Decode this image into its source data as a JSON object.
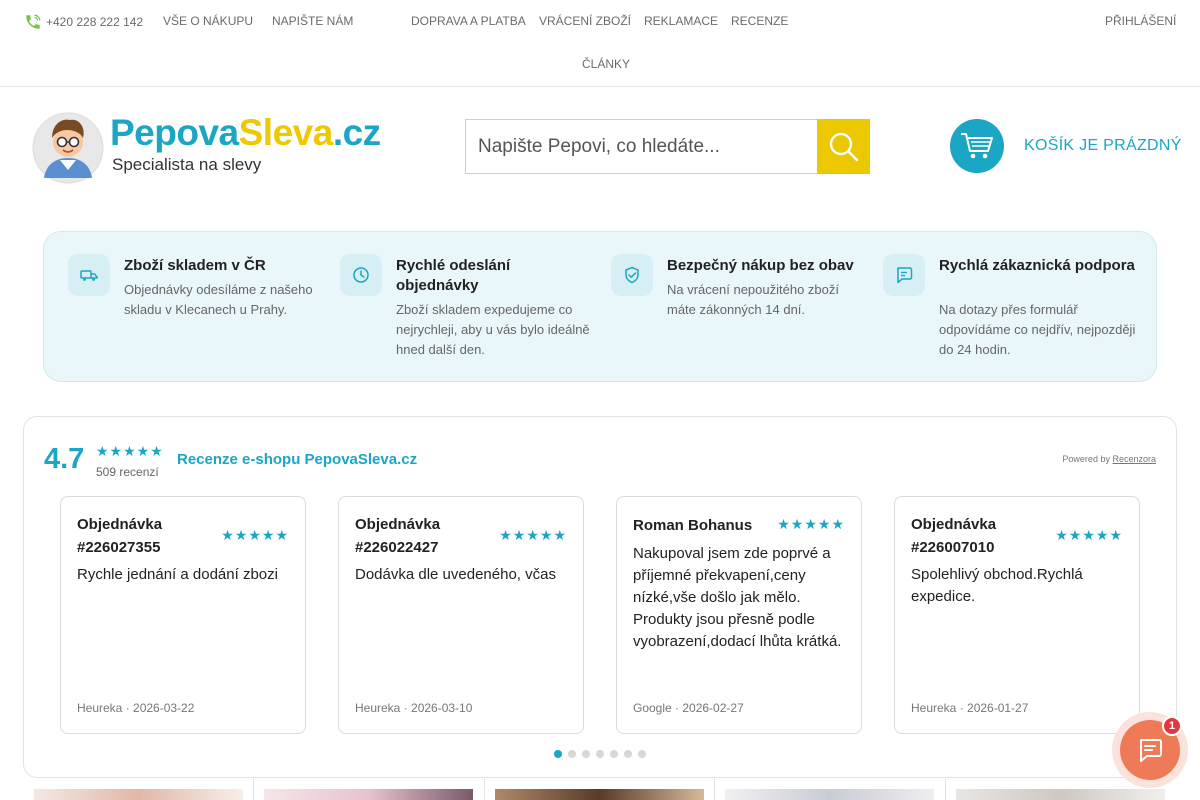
{
  "topbar": {
    "phone": "+420 228 222 142",
    "links": [
      "VŠE O NÁKUPU",
      "NAPIŠTE NÁM",
      "DOPRAVA A PLATBA",
      "VRÁCENÍ ZBOŽÍ",
      "REKLAMACE",
      "RECENZE",
      "ČLÁNKY"
    ],
    "login": "PŘIHLÁŠENÍ"
  },
  "header": {
    "brand_part1": "Pepova",
    "brand_part2": "Sleva",
    "brand_part3": ".cz",
    "tagline": "Specialista na slevy",
    "search_placeholder": "Napište Pepovi, co hledáte...",
    "cart_label": "KOŠÍK JE PRÁZDNÝ"
  },
  "benefits": [
    {
      "icon": "truck-icon",
      "title": "Zboží skladem v ČR",
      "desc": "Objednávky odesíláme z našeho skladu v Klecanech u Prahy."
    },
    {
      "icon": "clock-icon",
      "title": "Rychlé odeslání objednávky",
      "desc": "Zboží skladem expedujeme co nejrychleji, aby u vás bylo ideálně hned další den."
    },
    {
      "icon": "shield-check-icon",
      "title": "Bezpečný nákup bez obav",
      "desc": "Na vrácení nepoužitého zboží máte zákonných 14 dní."
    },
    {
      "icon": "chat-icon",
      "title": "Rychlá zákaznická podpora",
      "desc": "Na dotazy přes formulář odpovídáme co nejdřív, nejpozději do 24 hodin."
    }
  ],
  "reviews": {
    "score": "4.7",
    "stars": "★★★★★",
    "count": "509 recenzí",
    "title": "Recenze e-shopu PepovaSleva.cz",
    "powered_prefix": "Powered by",
    "powered_brand": "Recenzora",
    "items": [
      {
        "name": "Objednávka #226027355",
        "stars": "★★★★★",
        "text": "Rychle jednání a dodání zbozi",
        "meta": "Heureka · 2026-03-22"
      },
      {
        "name": "Objednávka #226022427",
        "stars": "★★★★★",
        "text": "Dodávka dle uvedeného, včas",
        "meta": "Heureka · 2026-03-10"
      },
      {
        "name": "Roman Bohanus",
        "stars": "★★★★★",
        "text": "Nakupoval jsem zde poprvé a příjemné překvapení,ceny nízké,vše došlo jak mělo. Produkty jsou přesně podle vyobrazení,dodací lhůta krátká.",
        "meta": "Google · 2026-02-27"
      },
      {
        "name": "Objednávka #226007010",
        "stars": "★★★★★",
        "text": "Spolehlivý obchod.Rychlá expedice.",
        "meta": "Heureka · 2026-01-27"
      }
    ],
    "dots_total": 7,
    "dots_active": 0
  },
  "chat": {
    "badge": "1"
  },
  "colors": {
    "accent": "#1aa6c4",
    "yellow": "#ecc800",
    "chat": "#ef7a57"
  }
}
